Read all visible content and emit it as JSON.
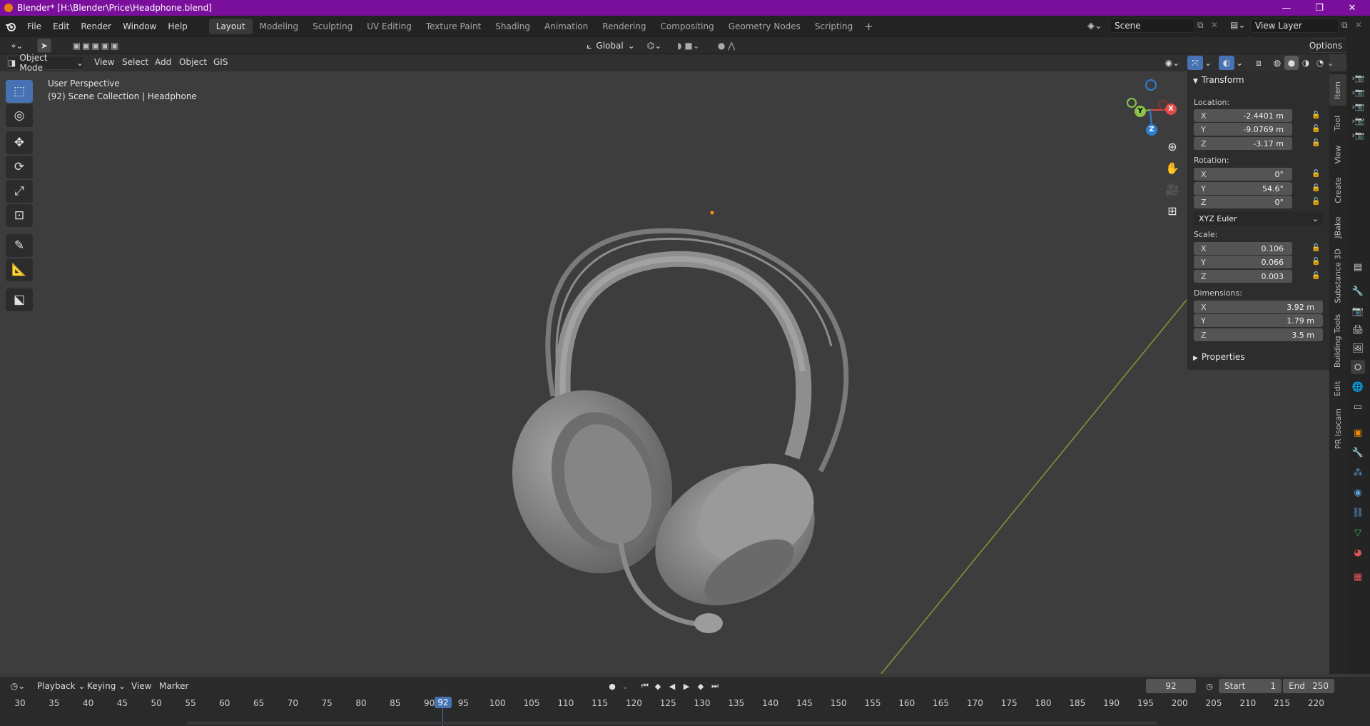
{
  "window": {
    "title": "Blender* [H:\\Blender\\Price\\Headphone.blend]",
    "minimize": "—",
    "restore": "❐",
    "close": "✕"
  },
  "topmenu": [
    "File",
    "Edit",
    "Render",
    "Window",
    "Help"
  ],
  "workspaces": [
    "Layout",
    "Modeling",
    "Sculpting",
    "UV Editing",
    "Texture Paint",
    "Shading",
    "Animation",
    "Rendering",
    "Compositing",
    "Geometry Nodes",
    "Scripting"
  ],
  "add_workspace": "+",
  "scene_name": "Scene",
  "view_layer": "View Layer",
  "tool_header": {
    "orientation": "Global",
    "options": "Options"
  },
  "viewport_header": {
    "mode": "Object Mode",
    "menus": [
      "View",
      "Select",
      "Add",
      "Object",
      "GIS"
    ]
  },
  "viewport_info": {
    "line1": "User Perspective",
    "line2": "(92) Scene Collection | Headphone"
  },
  "gizmo": {
    "x": "X",
    "y": "Y",
    "z": "Z"
  },
  "npanel": {
    "transform_title": "Transform",
    "location_label": "Location:",
    "location": [
      {
        "axis": "X",
        "value": "-2.4401 m"
      },
      {
        "axis": "Y",
        "value": "-9.0769 m"
      },
      {
        "axis": "Z",
        "value": "-3.17 m"
      }
    ],
    "rotation_label": "Rotation:",
    "rotation": [
      {
        "axis": "X",
        "value": "0°"
      },
      {
        "axis": "Y",
        "value": "54.6°"
      },
      {
        "axis": "Z",
        "value": "0°"
      }
    ],
    "rotation_mode": "XYZ Euler",
    "scale_label": "Scale:",
    "scale": [
      {
        "axis": "X",
        "value": "0.106"
      },
      {
        "axis": "Y",
        "value": "0.066"
      },
      {
        "axis": "Z",
        "value": "0.003"
      }
    ],
    "dimensions_label": "Dimensions:",
    "dimensions": [
      {
        "axis": "X",
        "value": "3.92 m"
      },
      {
        "axis": "Y",
        "value": "1.79 m"
      },
      {
        "axis": "Z",
        "value": "3.5 m"
      }
    ],
    "properties_title": "Properties"
  },
  "side_tabs": [
    "Item",
    "Tool",
    "View",
    "Create",
    "JBake",
    "Substance 3D",
    "Building Tools",
    "Edit",
    "PR Isocam"
  ],
  "timeline_header": {
    "menus": [
      "Playback",
      "Keying",
      "View",
      "Marker"
    ],
    "current_frame": "92",
    "start_label": "Start",
    "start": "1",
    "end_label": "End",
    "end": "250"
  },
  "timeline_ticks": [
    "30",
    "35",
    "40",
    "45",
    "50",
    "55",
    "60",
    "65",
    "70",
    "75",
    "80",
    "85",
    "90",
    "95",
    "100",
    "105",
    "110",
    "115",
    "120",
    "125",
    "130",
    "135",
    "140",
    "145",
    "150",
    "155",
    "160",
    "165",
    "170",
    "175",
    "180",
    "185",
    "190",
    "195",
    "200",
    "205",
    "210",
    "215",
    "220"
  ],
  "playhead": "92",
  "colors": {
    "accent": "#4772b3",
    "title_bar": "#7a0f9c",
    "gizmo_x": "#e44a4a",
    "gizmo_y": "#8bc34a",
    "gizmo_z": "#2f7fd6"
  }
}
